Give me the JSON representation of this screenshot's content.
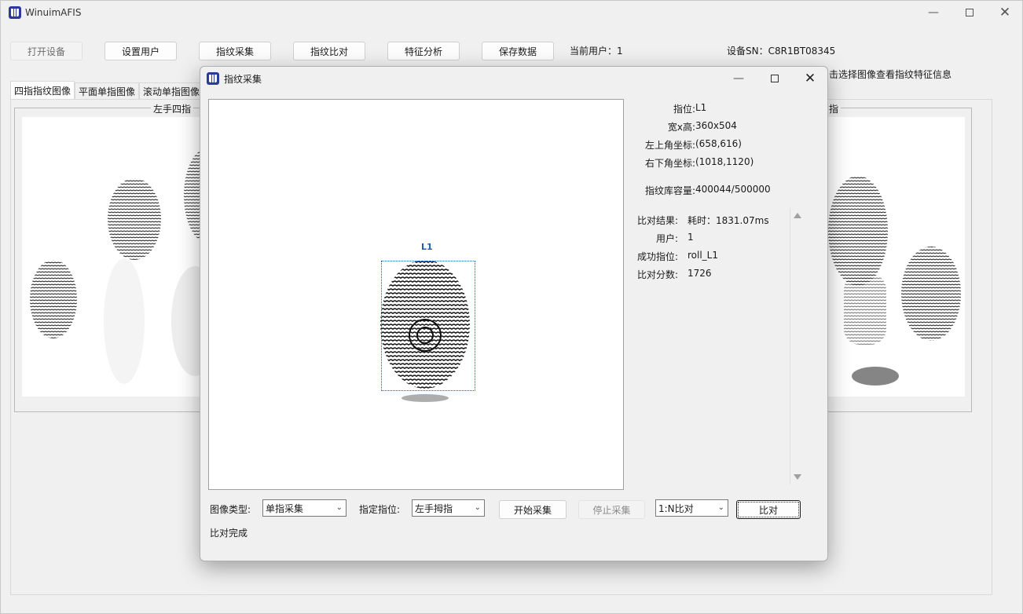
{
  "app": {
    "title": "WinuimAFIS"
  },
  "toolbar": {
    "open_device": "打开设备",
    "set_user": "设置用户",
    "capture": "指纹采集",
    "compare": "指纹比对",
    "feature_analysis": "特征分析",
    "save_data": "保存数据",
    "current_user_label": "当前用户：1",
    "device_sn_label": "设备SN：C8R1BT08345",
    "hint_text": "击选择图像查看指纹特征信息"
  },
  "tabs": [
    {
      "label": "四指指纹图像"
    },
    {
      "label": "平面单指图像"
    },
    {
      "label": "滚动单指图像"
    }
  ],
  "groups": {
    "left_four": "左手四指",
    "right_four_partial": "指"
  },
  "dialog": {
    "title": "指纹采集",
    "preview_finger_label": "L1",
    "info": {
      "finger_pos_key": "指位:",
      "finger_pos_val": "L1",
      "size_key": "宽x高:",
      "size_val": "360x504",
      "topleft_key": "左上角坐标:",
      "topleft_val": "(658,616)",
      "bottomright_key": "右下角坐标:",
      "bottomright_val": "(1018,1120)",
      "capacity_key": "指纹库容量:",
      "capacity_val": "400044/500000"
    },
    "result": {
      "result_key": "比对结果:",
      "result_val": "耗时：1831.07ms",
      "user_key": "用户:",
      "user_val": "1",
      "success_key": "成功指位:",
      "success_val": "roll_L1",
      "score_key": "比对分数:",
      "score_val": "1726"
    },
    "controls": {
      "image_type_label": "图像类型:",
      "image_type_value": "单指采集",
      "finger_label": "指定指位:",
      "finger_value": "左手拇指",
      "start_button": "开始采集",
      "stop_button": "停止采集",
      "mode_value": "1:N比对",
      "compare_button": "比对"
    },
    "status": "比对完成"
  },
  "colors": {
    "accent": "#1f5fa6",
    "logo": "#2a3a9a"
  }
}
